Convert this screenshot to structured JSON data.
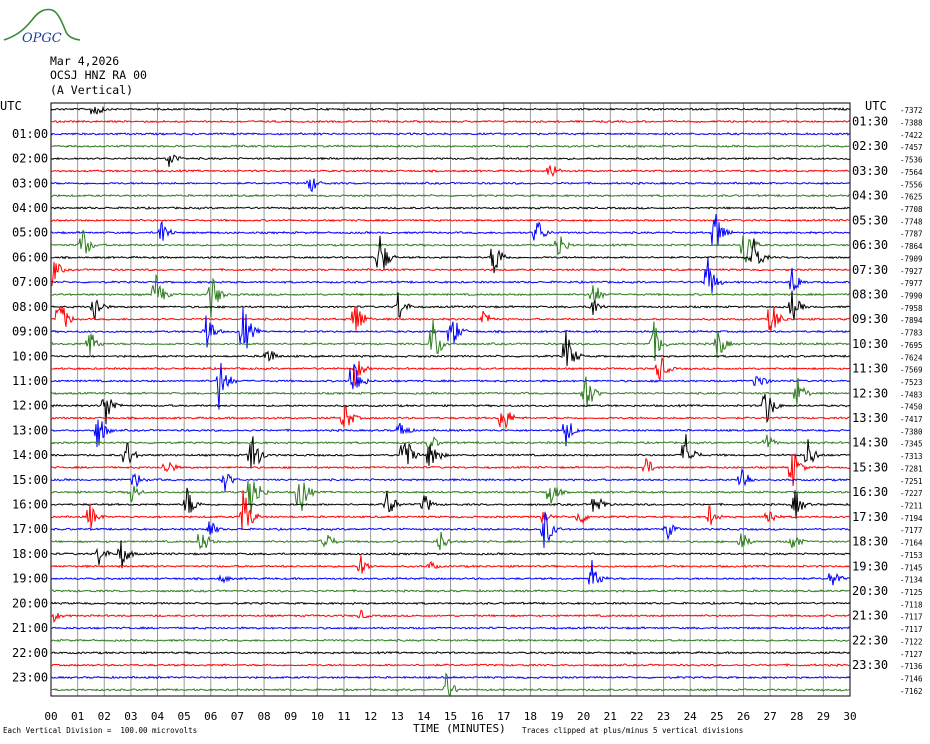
{
  "logo": {
    "text": "OPGC",
    "colors": {
      "arc": "#3a8a3a",
      "text": "#1f3fa0"
    }
  },
  "header": {
    "date": "Mar 4,2026",
    "station": "OCSJ HNZ RA 00",
    "component": "(A Vertical)"
  },
  "timezone_left": "UTC",
  "timezone_right": "UTC",
  "footer": {
    "left": "Each Vertical Division =  100.00 microvolts",
    "center": "TIME (MINUTES)",
    "right": "Traces clipped at plus/minus 5 vertical divisions"
  },
  "chart_data": {
    "type": "helicorder",
    "trace_colors": [
      "#000000",
      "#ff0000",
      "#0000ff",
      "#2e7d1f"
    ],
    "grid_color": "#9a9a9a",
    "xlabel": "TIME (MINUTES)",
    "x_ticks": [
      "00",
      "01",
      "02",
      "03",
      "04",
      "05",
      "06",
      "07",
      "08",
      "09",
      "10",
      "11",
      "12",
      "13",
      "14",
      "15",
      "16",
      "17",
      "18",
      "19",
      "20",
      "21",
      "22",
      "23",
      "24",
      "25",
      "26",
      "27",
      "28",
      "29",
      "30"
    ],
    "xlim": [
      0,
      30
    ],
    "left_labels": [
      "01:00",
      "02:00",
      "03:00",
      "04:00",
      "05:00",
      "06:00",
      "07:00",
      "08:00",
      "09:00",
      "10:00",
      "11:00",
      "12:00",
      "13:00",
      "14:00",
      "15:00",
      "16:00",
      "17:00",
      "18:00",
      "19:00",
      "20:00",
      "21:00",
      "22:00",
      "23:00"
    ],
    "right_labels": [
      "01:30",
      "02:30",
      "03:30",
      "04:30",
      "05:30",
      "06:30",
      "07:30",
      "08:30",
      "09:30",
      "10:30",
      "11:30",
      "12:30",
      "13:30",
      "14:30",
      "15:30",
      "16:30",
      "17:30",
      "18:30",
      "19:30",
      "20:30",
      "21:30",
      "22:30",
      "23:30"
    ],
    "offsets": [
      "-7372",
      "-7388",
      "-7422",
      "-7457",
      "-7536",
      "-7564",
      "-7556",
      "-7625",
      "-7708",
      "-7748",
      "-7787",
      "-7864",
      "-7909",
      "-7927",
      "-7977",
      "-7990",
      "-7958",
      "-7894",
      "-7783",
      "-7695",
      "-7624",
      "-7569",
      "-7523",
      "-7483",
      "-7450",
      "-7417",
      "-7380",
      "-7345",
      "-7313",
      "-7281",
      "-7251",
      "-7227",
      "-7211",
      "-7194",
      "-7177",
      "-7164",
      "-7153",
      "-7145",
      "-7134",
      "-7125",
      "-7118",
      "-7117",
      "-7117",
      "-7122",
      "-7127",
      "-7136",
      "-7146",
      "-7162"
    ],
    "events": [
      {
        "row": 0,
        "minute": 1.6,
        "amp": 2
      },
      {
        "row": 4,
        "minute": 4.4,
        "amp": 2
      },
      {
        "row": 5,
        "minute": 18.7,
        "amp": 2
      },
      {
        "row": 6,
        "minute": 9.7,
        "amp": 2
      },
      {
        "row": 10,
        "minute": 4.1,
        "amp": 3
      },
      {
        "row": 10,
        "minute": 18.2,
        "amp": 3
      },
      {
        "row": 10,
        "minute": 24.9,
        "amp": 5
      },
      {
        "row": 11,
        "minute": 1.1,
        "amp": 4
      },
      {
        "row": 11,
        "minute": 19.0,
        "amp": 3
      },
      {
        "row": 11,
        "minute": 26.0,
        "amp": 5
      },
      {
        "row": 12,
        "minute": 12.3,
        "amp": 5
      },
      {
        "row": 12,
        "minute": 16.6,
        "amp": 4
      },
      {
        "row": 12,
        "minute": 26.3,
        "amp": 5
      },
      {
        "row": 13,
        "minute": 0.0,
        "amp": 3
      },
      {
        "row": 14,
        "minute": 24.6,
        "amp": 5
      },
      {
        "row": 14,
        "minute": 27.8,
        "amp": 3
      },
      {
        "row": 15,
        "minute": 3.9,
        "amp": 4
      },
      {
        "row": 15,
        "minute": 6.0,
        "amp": 4
      },
      {
        "row": 15,
        "minute": 20.3,
        "amp": 3
      },
      {
        "row": 16,
        "minute": 1.6,
        "amp": 3
      },
      {
        "row": 16,
        "minute": 13.0,
        "amp": 3
      },
      {
        "row": 16,
        "minute": 20.3,
        "amp": 2
      },
      {
        "row": 16,
        "minute": 27.8,
        "amp": 3
      },
      {
        "row": 17,
        "minute": 0.3,
        "amp": 4
      },
      {
        "row": 17,
        "minute": 11.4,
        "amp": 4
      },
      {
        "row": 17,
        "minute": 16.2,
        "amp": 2
      },
      {
        "row": 17,
        "minute": 27.0,
        "amp": 4
      },
      {
        "row": 18,
        "minute": 5.8,
        "amp": 4
      },
      {
        "row": 18,
        "minute": 7.2,
        "amp": 5
      },
      {
        "row": 18,
        "minute": 15.0,
        "amp": 4
      },
      {
        "row": 19,
        "minute": 1.4,
        "amp": 3
      },
      {
        "row": 19,
        "minute": 14.3,
        "amp": 5
      },
      {
        "row": 19,
        "minute": 22.6,
        "amp": 4
      },
      {
        "row": 19,
        "minute": 25.0,
        "amp": 3
      },
      {
        "row": 20,
        "minute": 8.1,
        "amp": 2
      },
      {
        "row": 20,
        "minute": 19.3,
        "amp": 5
      },
      {
        "row": 21,
        "minute": 11.4,
        "amp": 3
      },
      {
        "row": 21,
        "minute": 22.8,
        "amp": 3
      },
      {
        "row": 22,
        "minute": 6.3,
        "amp": 5
      },
      {
        "row": 22,
        "minute": 11.3,
        "amp": 5
      },
      {
        "row": 22,
        "minute": 26.5,
        "amp": 2
      },
      {
        "row": 23,
        "minute": 20.0,
        "amp": 5
      },
      {
        "row": 23,
        "minute": 28.0,
        "amp": 3
      },
      {
        "row": 24,
        "minute": 2.0,
        "amp": 4
      },
      {
        "row": 24,
        "minute": 26.8,
        "amp": 4
      },
      {
        "row": 25,
        "minute": 11.0,
        "amp": 3
      },
      {
        "row": 25,
        "minute": 16.9,
        "amp": 4
      },
      {
        "row": 26,
        "minute": 1.7,
        "amp": 4
      },
      {
        "row": 26,
        "minute": 13.1,
        "amp": 2
      },
      {
        "row": 26,
        "minute": 19.3,
        "amp": 3
      },
      {
        "row": 27,
        "minute": 14.2,
        "amp": 2
      },
      {
        "row": 27,
        "minute": 26.8,
        "amp": 2
      },
      {
        "row": 28,
        "minute": 2.8,
        "amp": 3
      },
      {
        "row": 28,
        "minute": 7.5,
        "amp": 5
      },
      {
        "row": 28,
        "minute": 13.2,
        "amp": 5
      },
      {
        "row": 28,
        "minute": 14.2,
        "amp": 4
      },
      {
        "row": 28,
        "minute": 23.8,
        "amp": 4
      },
      {
        "row": 28,
        "minute": 28.4,
        "amp": 3
      },
      {
        "row": 29,
        "minute": 4.3,
        "amp": 2
      },
      {
        "row": 29,
        "minute": 22.3,
        "amp": 2
      },
      {
        "row": 29,
        "minute": 27.8,
        "amp": 4
      },
      {
        "row": 30,
        "minute": 3.1,
        "amp": 2
      },
      {
        "row": 30,
        "minute": 6.5,
        "amp": 2
      },
      {
        "row": 30,
        "minute": 25.9,
        "amp": 3
      },
      {
        "row": 31,
        "minute": 3.0,
        "amp": 2
      },
      {
        "row": 31,
        "minute": 7.5,
        "amp": 5
      },
      {
        "row": 31,
        "minute": 9.3,
        "amp": 5
      },
      {
        "row": 31,
        "minute": 18.7,
        "amp": 3
      },
      {
        "row": 32,
        "minute": 5.1,
        "amp": 3
      },
      {
        "row": 32,
        "minute": 12.6,
        "amp": 3
      },
      {
        "row": 32,
        "minute": 14.0,
        "amp": 2
      },
      {
        "row": 32,
        "minute": 20.4,
        "amp": 3
      },
      {
        "row": 32,
        "minute": 27.9,
        "amp": 3
      },
      {
        "row": 33,
        "minute": 1.4,
        "amp": 3
      },
      {
        "row": 33,
        "minute": 7.2,
        "amp": 5
      },
      {
        "row": 33,
        "minute": 18.4,
        "amp": 2
      },
      {
        "row": 33,
        "minute": 19.8,
        "amp": 2
      },
      {
        "row": 33,
        "minute": 24.7,
        "amp": 2
      },
      {
        "row": 33,
        "minute": 26.9,
        "amp": 2
      },
      {
        "row": 34,
        "minute": 5.9,
        "amp": 2
      },
      {
        "row": 34,
        "minute": 18.5,
        "amp": 4
      },
      {
        "row": 34,
        "minute": 23.1,
        "amp": 2
      },
      {
        "row": 35,
        "minute": 5.6,
        "amp": 3
      },
      {
        "row": 35,
        "minute": 10.2,
        "amp": 3
      },
      {
        "row": 35,
        "minute": 14.6,
        "amp": 2
      },
      {
        "row": 35,
        "minute": 25.9,
        "amp": 2
      },
      {
        "row": 35,
        "minute": 27.8,
        "amp": 2
      },
      {
        "row": 36,
        "minute": 1.8,
        "amp": 2
      },
      {
        "row": 36,
        "minute": 2.6,
        "amp": 3
      },
      {
        "row": 37,
        "minute": 11.6,
        "amp": 2
      },
      {
        "row": 37,
        "minute": 14.2,
        "amp": 1
      },
      {
        "row": 38,
        "minute": 6.4,
        "amp": 1
      },
      {
        "row": 38,
        "minute": 20.3,
        "amp": 3
      },
      {
        "row": 38,
        "minute": 29.3,
        "amp": 2
      },
      {
        "row": 41,
        "minute": 0.1,
        "amp": 1
      },
      {
        "row": 41,
        "minute": 11.6,
        "amp": 1
      },
      {
        "row": 47,
        "minute": 14.8,
        "amp": 3
      }
    ]
  }
}
